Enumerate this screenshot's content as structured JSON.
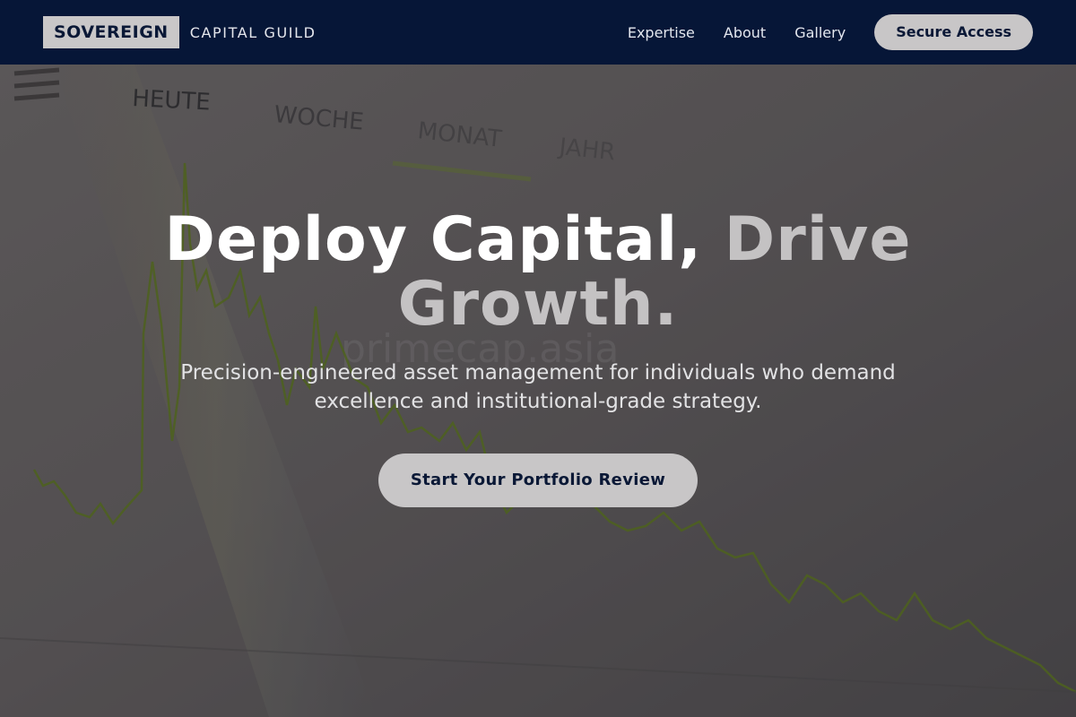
{
  "brand": {
    "name": "SOVEREIGN",
    "tagline": "CAPITAL GUILD"
  },
  "nav": {
    "links": [
      "Expertise",
      "About",
      "Gallery"
    ],
    "cta": "Secure Access"
  },
  "hero": {
    "headline_main": "Deploy Capital,",
    "headline_accent": "Drive Growth.",
    "subtext": "Precision-engineered asset management for individuals who demand excellence and institutional-grade strategy.",
    "cta": "Start Your Portfolio Review",
    "background": {
      "tabs": [
        "HEUTE",
        "WOCHE",
        "MONAT",
        "JAHR"
      ],
      "watermark": "primecap.asia"
    }
  },
  "colors": {
    "header_bg": "#061637",
    "brand_navy": "#0a1836",
    "button_bg": "#c8c6c7",
    "headline_accent": "#c4c2c3",
    "chart_line": "#5e7a1a"
  }
}
